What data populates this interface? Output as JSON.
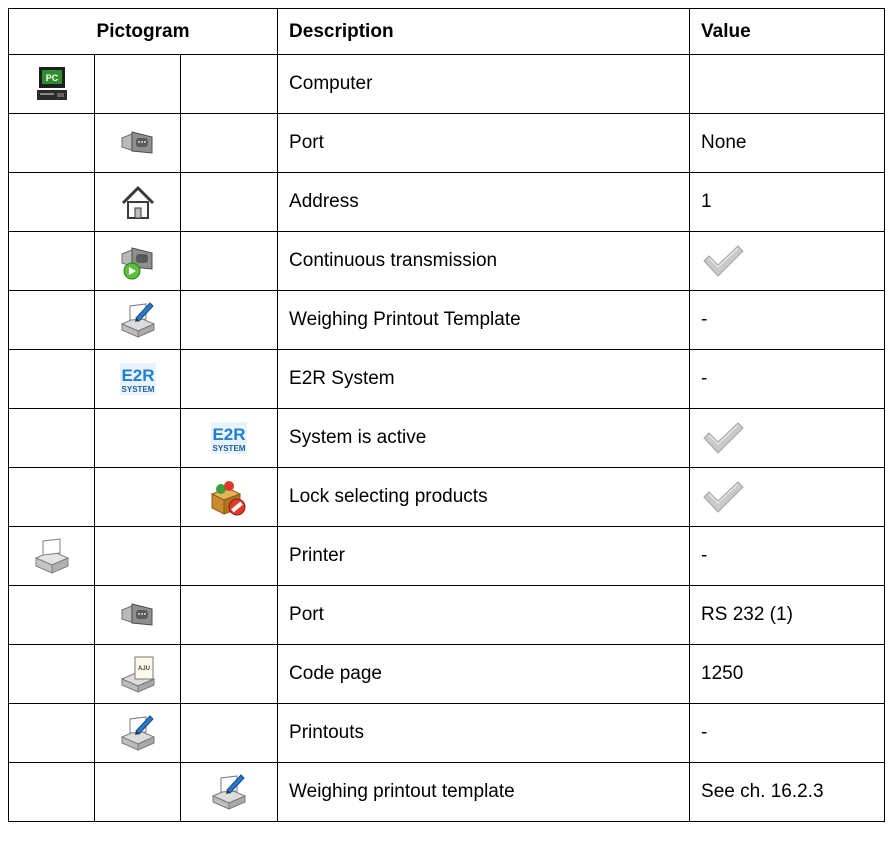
{
  "header": {
    "pictogram": "Pictogram",
    "description": "Description",
    "value": "Value"
  },
  "rows": [
    {
      "level": 1,
      "icon": "computer-icon",
      "description": "Computer",
      "value": ""
    },
    {
      "level": 2,
      "icon": "port-icon",
      "description": "Port",
      "value": "None"
    },
    {
      "level": 2,
      "icon": "home-icon",
      "description": "Address",
      "value": "1"
    },
    {
      "level": 2,
      "icon": "continuous-transmission-icon",
      "description": "Continuous transmission",
      "value": "",
      "checked": true
    },
    {
      "level": 2,
      "icon": "printout-template-icon",
      "description": "Weighing Printout Template",
      "value": "-"
    },
    {
      "level": 2,
      "icon": "e2r-system-icon",
      "description": "E2R System",
      "value": "-"
    },
    {
      "level": 3,
      "icon": "e2r-system-icon",
      "description": "System is active",
      "value": "",
      "checked": true
    },
    {
      "level": 3,
      "icon": "lock-products-icon",
      "description": "Lock selecting products",
      "value": "",
      "checked": true
    },
    {
      "level": 1,
      "icon": "printer-icon",
      "description": "Printer",
      "value": "-"
    },
    {
      "level": 2,
      "icon": "port-icon",
      "description": "Port",
      "value": "RS 232 (1)"
    },
    {
      "level": 2,
      "icon": "code-page-icon",
      "description": "Code page",
      "value": "1250"
    },
    {
      "level": 2,
      "icon": "printout-template-icon",
      "description": "Printouts",
      "value": "-"
    },
    {
      "level": 3,
      "icon": "printout-template-icon",
      "description": "Weighing printout template",
      "value": "See ch. 16.2.3"
    }
  ],
  "icon_labels": {
    "computer": "PC",
    "e2r_top": "E2R",
    "e2r_bottom": "SYSTEM",
    "code_page": "AJU"
  }
}
